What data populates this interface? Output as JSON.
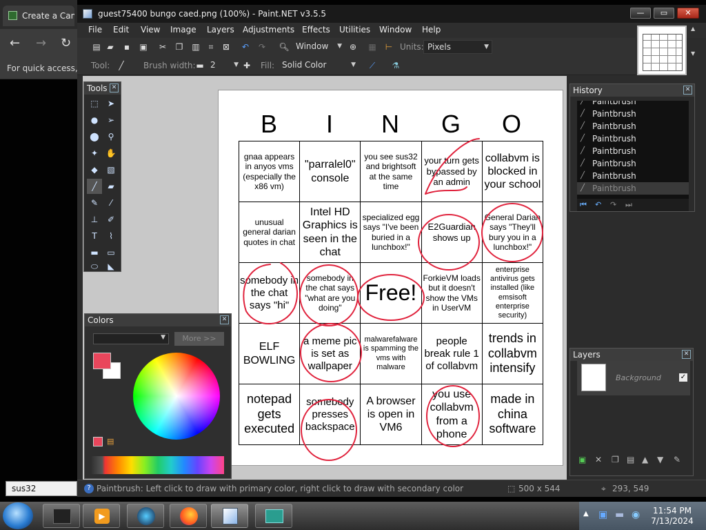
{
  "browser": {
    "tab_title": "Create a Canad",
    "bookmark_bar_text": "For quick access, p",
    "search_text": "sus32"
  },
  "window": {
    "title": "guest75400 bungo caed.png (100%) - Paint.NET v3.5.5",
    "min": "—",
    "max": "▭",
    "close": "✕"
  },
  "menu": [
    "File",
    "Edit",
    "View",
    "Image",
    "Layers",
    "Adjustments",
    "Effects",
    "Utilities",
    "Window",
    "Help"
  ],
  "toolbar": {
    "window_label": "Window",
    "units_label": "Units:",
    "units_value": "Pixels",
    "tool_label": "Tool:",
    "brush_width_label": "Brush width:",
    "brush_width_value": "2",
    "fill_label": "Fill:",
    "fill_value": "Solid Color"
  },
  "tools_panel": {
    "title": "Tools"
  },
  "history_panel": {
    "title": "History",
    "items": [
      "Paintbrush",
      "Paintbrush",
      "Paintbrush",
      "Paintbrush",
      "Paintbrush",
      "Paintbrush",
      "Paintbrush",
      "Paintbrush"
    ]
  },
  "colors_panel": {
    "title": "Colors",
    "more_button": "More >>",
    "primary_color": "#e9465c",
    "secondary_color": "#ffffff"
  },
  "layers_panel": {
    "title": "Layers",
    "layer_name": "Background",
    "visible": "✓"
  },
  "canvas": {
    "headers": [
      "B",
      "I",
      "N",
      "G",
      "O"
    ],
    "cells": [
      [
        "gnaa appears in anyos vms (especially the x86 vm)",
        "\"parralel0\" console",
        "you see sus32 and brightsoft at the same time",
        "your turn gets bypassed by an admin",
        "collabvm is blocked in your school"
      ],
      [
        "unusual general darian quotes in chat",
        "Intel HD Graphics is seen in the chat",
        "specialized egg says \"I've been buried in a lunchbox!\"",
        "E2Guardian shows up",
        "General Darian says \"They'll bury you in a lunchbox!\""
      ],
      [
        "somebody in the chat says \"hi\"",
        "somebody in the chat says \"what are you doing\"",
        "Free!",
        "ForkieVM loads but it doesn't show the VMs in UserVM",
        "enterprise antivirus gets installed (like emsisoft enterprise security)"
      ],
      [
        "ELF BOWLING",
        "a meme pic is set as wallpaper",
        "malwarefalware is spamming the vms with malware",
        "people break rule 1 of collabvm",
        "trends in collabvm intensify"
      ],
      [
        "notepad gets executed",
        "somebody presses backspace",
        "A browser is open in VM6",
        "you use collabvm from a phone",
        "made in china software"
      ]
    ],
    "ink_color": "#e0223c"
  },
  "status": {
    "hint": "Paintbrush: Left click to draw with primary color, right click to draw with secondary color",
    "image_size": "500 x 544",
    "cursor": "293, 549"
  },
  "taskbar": {
    "time": "11:54 PM",
    "date": "7/13/2024"
  }
}
